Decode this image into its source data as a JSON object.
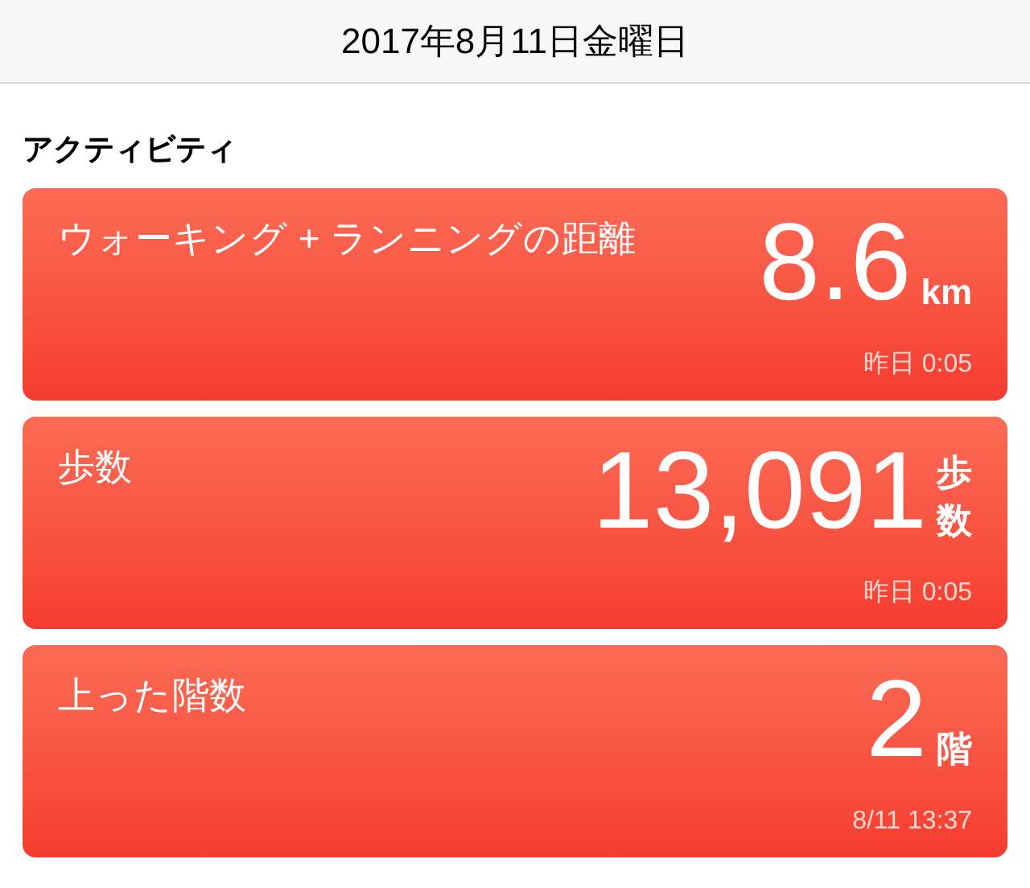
{
  "header": {
    "title": "2017年8月11日金曜日"
  },
  "section": {
    "title": "アクティビティ"
  },
  "cards": [
    {
      "title": "ウォーキング + ランニングの距離",
      "value": "8.6",
      "unit": "km",
      "time": "昨日 0:05"
    },
    {
      "title": "歩数",
      "value": "13,091",
      "unit": "歩数",
      "time": "昨日 0:05"
    },
    {
      "title": "上った階数",
      "value": "2",
      "unit": "階",
      "time": "8/11 13:37"
    }
  ]
}
